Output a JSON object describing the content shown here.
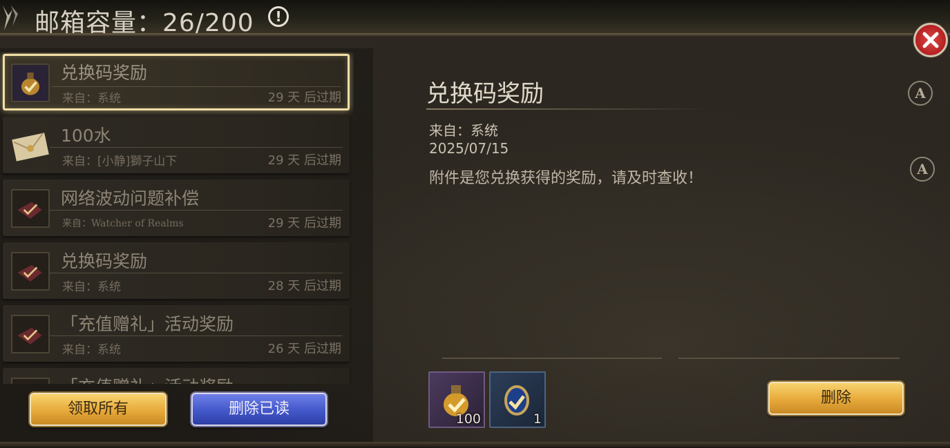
{
  "header": {
    "title": "邮箱容量：26/200",
    "info_icon": "!"
  },
  "mails": [
    {
      "title": "兑换码奖励",
      "from": "来自：系统",
      "expire": "29 天 后过期",
      "icon": "potion-icon",
      "selected": true
    },
    {
      "title": "100水",
      "from": "来自：[小静]獅子山下",
      "expire": "29 天 后过期",
      "icon": "envelope-icon"
    },
    {
      "title": "网络波动问题补偿",
      "from": "来自：Watcher of Realms",
      "expire": "29 天 后过期",
      "icon": "opened-letter-icon"
    },
    {
      "title": "兑换码奖励",
      "from": "来自：系统",
      "expire": "28 天 后过期",
      "icon": "opened-letter-icon"
    },
    {
      "title": "「充值赠礼」活动奖励",
      "from": "来自：系统",
      "expire": "26 天 后过期",
      "icon": "opened-letter-icon"
    },
    {
      "title": "「充值赠礼」活动奖励",
      "from": "",
      "expire": "",
      "icon": "opened-letter-icon"
    }
  ],
  "buttons": {
    "claim_all": "领取所有",
    "delete_read": "删除已读",
    "delete": "删除"
  },
  "detail": {
    "title": "兑换码奖励",
    "from": "来自：系统",
    "date": "2025/07/15",
    "body": "附件是您兑换获得的奖励，请及时查收！"
  },
  "attachments": [
    {
      "icon": "potion-icon",
      "count": "100"
    },
    {
      "icon": "eye-amulet-icon",
      "count": "1"
    }
  ],
  "side_icons": {
    "a1": "A",
    "a2": "A"
  },
  "colors": {
    "gold": "#e7a93a",
    "blue": "#4257c9",
    "close_red": "#c62828",
    "selected_border": "#f1dfa6"
  }
}
